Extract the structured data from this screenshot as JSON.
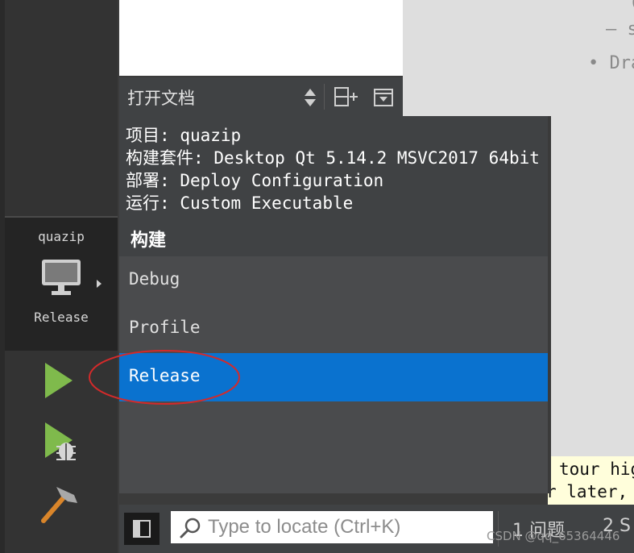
{
  "mode_bar": {
    "kit": {
      "project": "quazip",
      "configuration": "Release"
    },
    "buttons": [
      {
        "name": "run",
        "icon": "run-icon"
      },
      {
        "name": "debug",
        "icon": "debug-run-icon"
      },
      {
        "name": "build",
        "icon": "hammer-icon"
      }
    ]
  },
  "open_documents": {
    "label": "打开文档"
  },
  "editor": {
    "fragment_1": "C",
    "fragment_2": "– s",
    "fragment_3": "• Dra",
    "tour_note": [
      "tour hig",
      "r later,"
    ]
  },
  "kit_popup": {
    "info": [
      {
        "label": "项目:",
        "value": "quazip"
      },
      {
        "label": "构建套件:",
        "value": "Desktop Qt 5.14.2 MSVC2017 64bit"
      },
      {
        "label": "部署:",
        "value": "Deploy Configuration"
      },
      {
        "label": "运行:",
        "value": "Custom Executable"
      }
    ],
    "build_title": "构建",
    "build_configs": [
      "Debug",
      "Profile",
      "Release"
    ],
    "selected": "Release"
  },
  "bottom_bar": {
    "locator_placeholder": "Type to locate (Ctrl+K)",
    "tabs": [
      "1 问题",
      "2 S"
    ]
  },
  "watermark": "CSDN @qq_65364446",
  "colors": {
    "accent": "#0a72cf",
    "run_green": "#7fba4c",
    "annotation_red": "#d42a2a"
  }
}
